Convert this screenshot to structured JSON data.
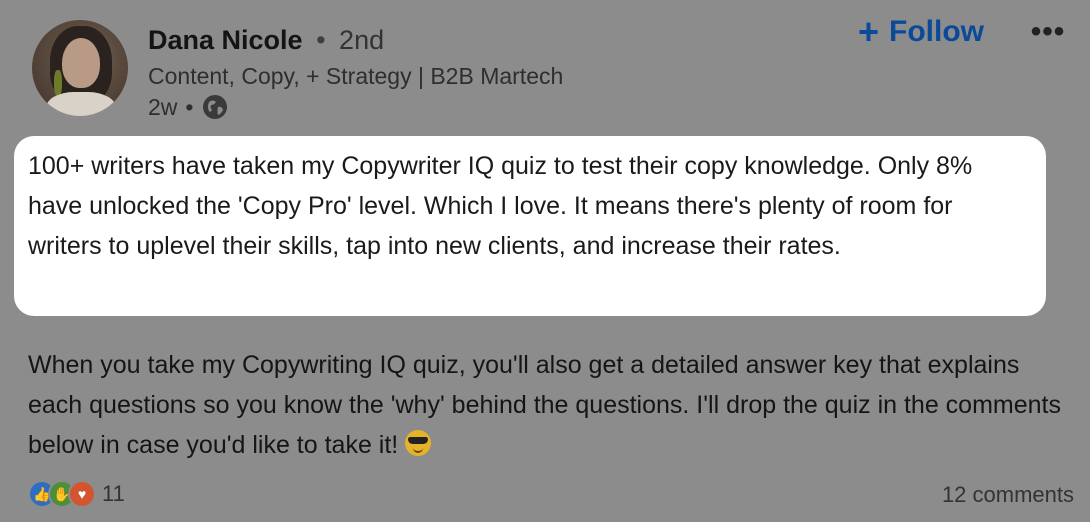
{
  "post": {
    "author": {
      "name": "Dana Nicole",
      "degree": "2nd",
      "headline": "Content, Copy, + Strategy | B2B Martech",
      "time": "2w",
      "visibility_icon": "globe-icon"
    },
    "follow_label": "Follow",
    "more_icon": "ellipsis-icon",
    "highlighted_text": "100+ writers have taken my Copywriter IQ quiz to test their copy knowledge. Only 8% have unlocked the 'Copy Pro' level. Which I love. It means there's plenty of room for writers to uplevel their skills, tap into new clients, and increase their rates.",
    "body_text": "When you take my Copywriting IQ quiz, you'll also get a detailed answer key that explains each questions so you know the 'why' behind the questions. I'll drop the quiz in the comments below in case you'd like to take it!",
    "body_emoji": "sunglasses-face-emoji",
    "reactions": {
      "icons": [
        "like-icon",
        "celebrate-icon",
        "love-icon"
      ],
      "count": "11"
    },
    "comments_label": "12 comments"
  },
  "colors": {
    "background": "#8c8c8c",
    "highlight": "#ffffff",
    "follow": "#0a4a99"
  }
}
